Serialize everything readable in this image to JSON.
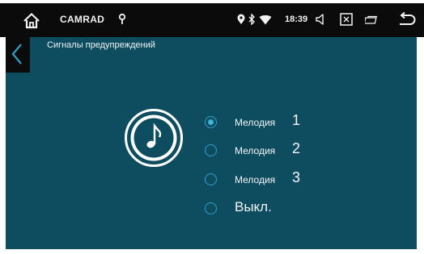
{
  "statusbar": {
    "app_name": "CAMRAD",
    "time": "18:39"
  },
  "page": {
    "title": "Сигналы предупреждений"
  },
  "options": [
    {
      "label": "Мелодия",
      "num": "1",
      "selected": true
    },
    {
      "label": "Мелодия",
      "num": "2",
      "selected": false
    },
    {
      "label": "Мелодия",
      "num": "3",
      "selected": false
    },
    {
      "label": "Выкл.",
      "num": "",
      "selected": false
    }
  ],
  "colors": {
    "panel_bg": "#0e4d60",
    "statusbar_bg": "#0b0b0b",
    "radio_accent": "#3fb2e0"
  },
  "icons": [
    "home-icon",
    "location-icon",
    "gps-icon",
    "bluetooth-icon",
    "wifi-icon",
    "volume-icon",
    "screenshot-icon",
    "window-icon",
    "return-icon",
    "back-arrow-icon",
    "music-note-icon"
  ]
}
